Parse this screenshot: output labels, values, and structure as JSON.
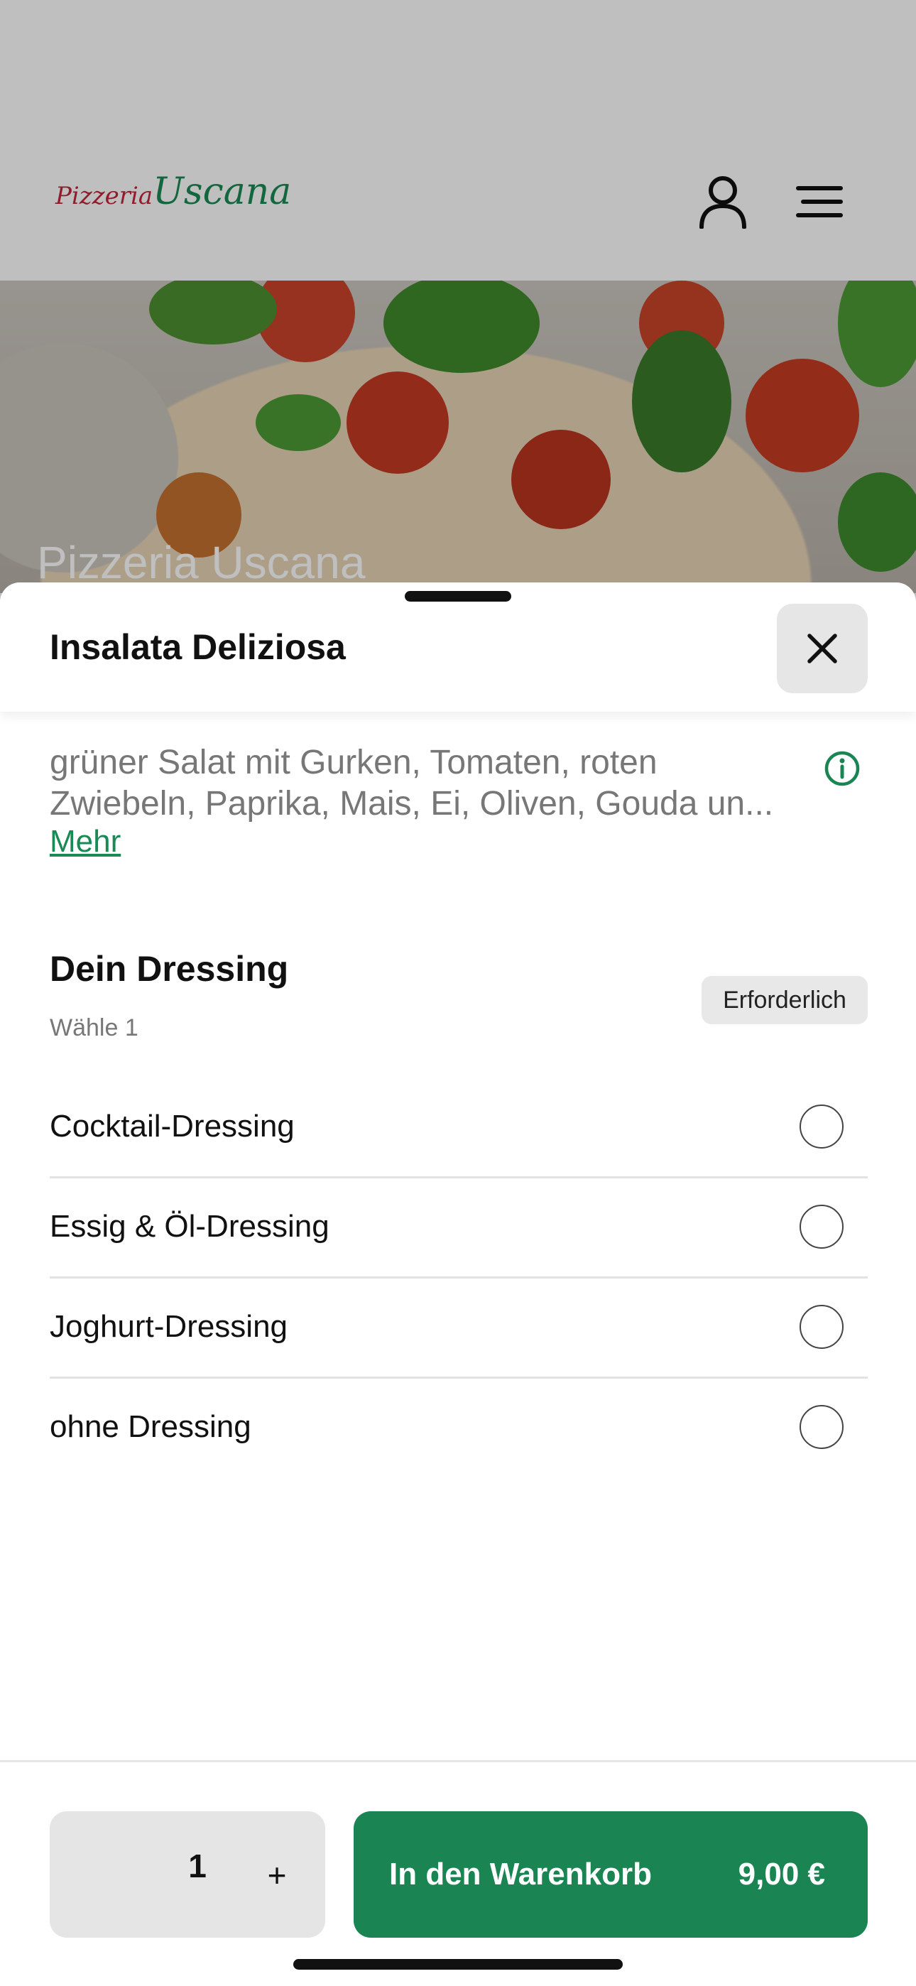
{
  "header": {
    "logo_part1": "Pizzeria",
    "logo_part2": "Uscana",
    "icons": [
      "user-icon",
      "menu-icon"
    ]
  },
  "hero": {
    "title": "Pizzeria Uscana"
  },
  "sheet": {
    "title": "Insalata Deliziosa",
    "description_line1": "grüner Salat mit Gurken, Tomaten, roten",
    "description_line2": "Zwiebeln, Paprika, Mais, Ei, Oliven, Gouda un...",
    "more_link": "Mehr",
    "section": {
      "title": "Dein Dressing",
      "subtitle": "Wähle 1",
      "badge": "Erforderlich",
      "options": [
        {
          "label": "Cocktail-Dressing",
          "selected": false
        },
        {
          "label": "Essig & Öl-Dressing",
          "selected": false
        },
        {
          "label": "Joghurt-Dressing",
          "selected": false
        },
        {
          "label": "ohne Dressing",
          "selected": false
        }
      ]
    }
  },
  "footer": {
    "quantity": "1",
    "plus_label": "+",
    "cart_label": "In den Warenkorb",
    "price": "9,00 €"
  },
  "colors": {
    "accent_green": "#1a8553",
    "logo_red": "#c2263a",
    "logo_green": "#1a8a55"
  }
}
